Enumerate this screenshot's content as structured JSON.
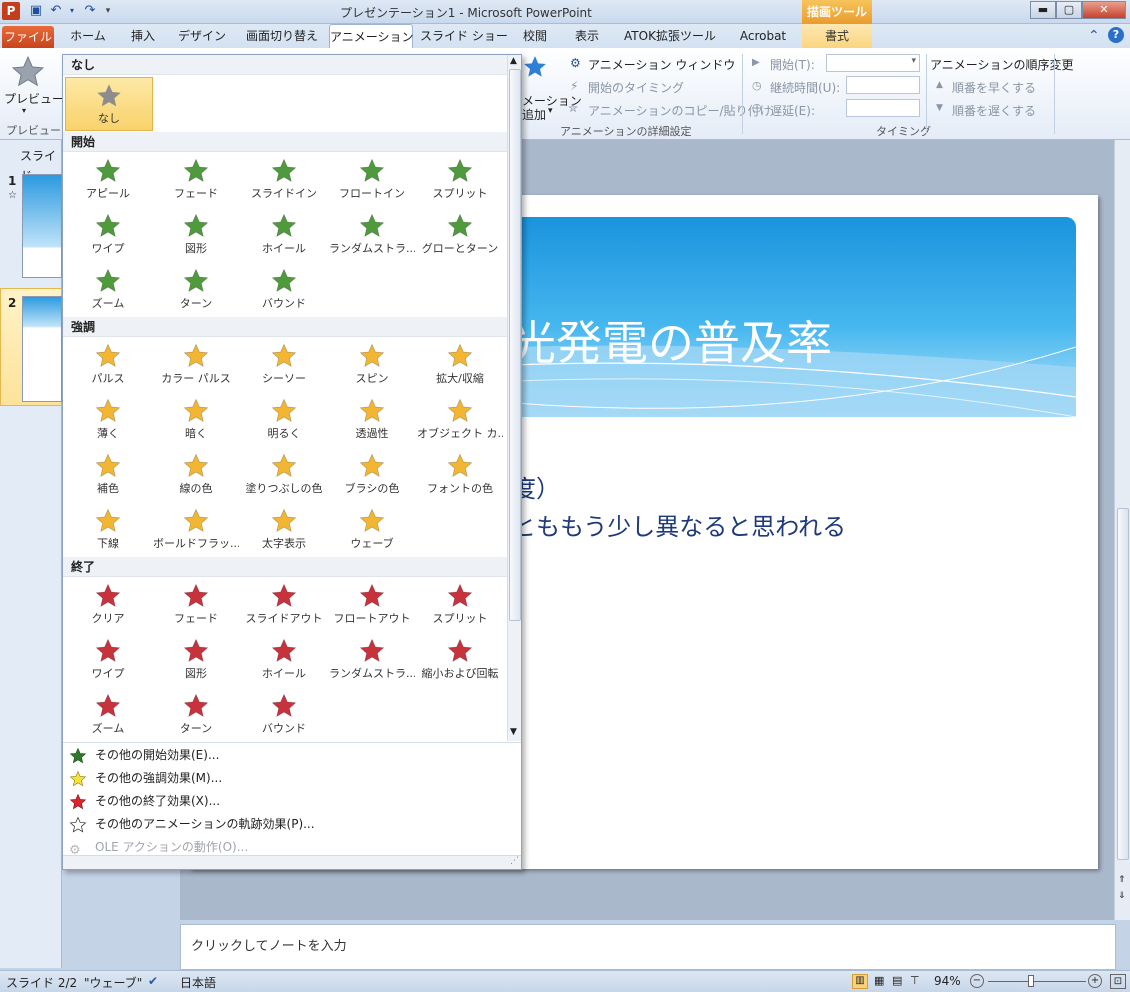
{
  "window": {
    "app_icon": "P",
    "title": "プレゼンテーション1 - Microsoft PowerPoint",
    "context_tab_header": "描画ツール"
  },
  "tabs": [
    "ファイル",
    "ホーム",
    "挿入",
    "デザイン",
    "画面切り替え",
    "アニメーション",
    "スライド ショー",
    "校閲",
    "表示",
    "ATOK拡張ツール",
    "Acrobat",
    "書式"
  ],
  "ribbon": {
    "preview_label": "プレビュー",
    "preview_group": "プレビュー",
    "add_animation_line1": "メーション",
    "add_animation_line2": "追加",
    "animation_window": "アニメーション ウィンドウ",
    "trigger": "開始のタイミング",
    "animation_painter": "アニメーションのコピー/貼り付け",
    "advanced_group": "アニメーションの詳細設定",
    "start_label": "開始(T):",
    "duration_label": "継続時間(U):",
    "delay_label": "遅延(E):",
    "timing_group": "タイミング",
    "reorder_title": "アニメーションの順序変更",
    "move_earlier": "順番を早くする",
    "move_later": "順番を遅くする"
  },
  "slides_pane": {
    "tab_label": "スライド",
    "slide1_num": "1",
    "slide2_num": "2"
  },
  "slide": {
    "title": "光発電の普及率",
    "bullet1": "度）",
    "bullet2": "とももう少し異なると思われる"
  },
  "notes_placeholder": "クリックしてノートを入力",
  "status": {
    "slide": "スライド 2/2",
    "theme": "\"ウェーブ\"",
    "language": "日本語",
    "zoom": "94%"
  },
  "gallery": {
    "none_header": "なし",
    "none_item": "なし",
    "entrance_header": "開始",
    "entrance": [
      "アピール",
      "フェード",
      "スライドイン",
      "フロートイン",
      "スプリット",
      "ワイプ",
      "図形",
      "ホイール",
      "ランダムストラ...",
      "グローとターン",
      "ズーム",
      "ターン",
      "バウンド"
    ],
    "emphasis_header": "強調",
    "emphasis": [
      "パルス",
      "カラー パルス",
      "シーソー",
      "スピン",
      "拡大/収縮",
      "薄く",
      "暗く",
      "明るく",
      "透過性",
      "オブジェクト カ...",
      "補色",
      "線の色",
      "塗りつぶしの色",
      "ブラシの色",
      "フォントの色",
      "下線",
      "ボールドフラッ...",
      "太字表示",
      "ウェーブ"
    ],
    "exit_header": "終了",
    "exit": [
      "クリア",
      "フェード",
      "スライドアウト",
      "フロートアウト",
      "スプリット",
      "ワイプ",
      "図形",
      "ホイール",
      "ランダムストラ...",
      "縮小および回転",
      "ズーム",
      "ターン",
      "バウンド"
    ],
    "menu": [
      "その他の開始効果(E)...",
      "その他の強調効果(M)...",
      "その他の終了効果(X)...",
      "その他のアニメーションの軌跡効果(P)...",
      "OLE アクションの動作(O)..."
    ]
  },
  "colors": {
    "entrance_star": "#4f9a3c",
    "emphasis_star": "#f2b632",
    "exit_star": "#c8323c",
    "none_star": "#8c8c8c",
    "file_tab": "#d24f23",
    "slide_blue": "#1b93dd"
  }
}
